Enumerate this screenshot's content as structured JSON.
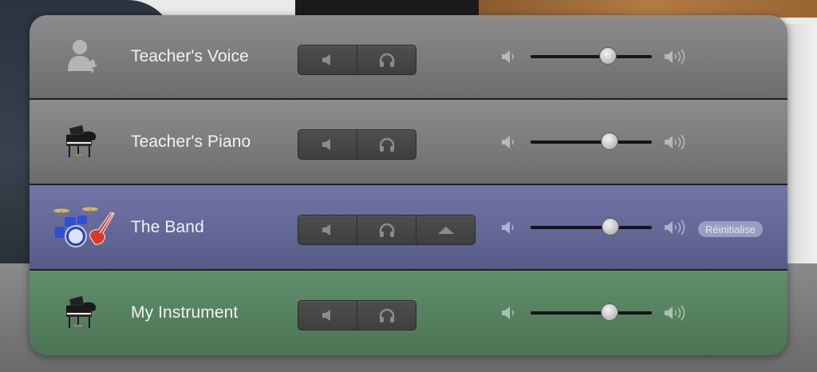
{
  "colors": {
    "gray_row": "#7b7b7b",
    "band_row": "#636897",
    "instrument_row": "#55805f",
    "reset_pill": "#9a9cc2"
  },
  "tracks": [
    {
      "label": "Teacher's Voice",
      "icon": "teacher-voice-icon",
      "volume_level": 0.64,
      "buttons": [
        "mute",
        "headphones"
      ]
    },
    {
      "label": "Teacher's Piano",
      "icon": "grand-piano-icon",
      "volume_level": 0.65,
      "buttons": [
        "mute",
        "headphones"
      ]
    },
    {
      "label": "The Band",
      "icon": "band-icon",
      "volume_level": 0.66,
      "buttons": [
        "mute",
        "headphones",
        "expand"
      ],
      "reset_label": "Réinitialise"
    },
    {
      "label": "My Instrument",
      "icon": "grand-piano-icon",
      "volume_level": 0.65,
      "buttons": [
        "mute",
        "headphones"
      ]
    }
  ]
}
